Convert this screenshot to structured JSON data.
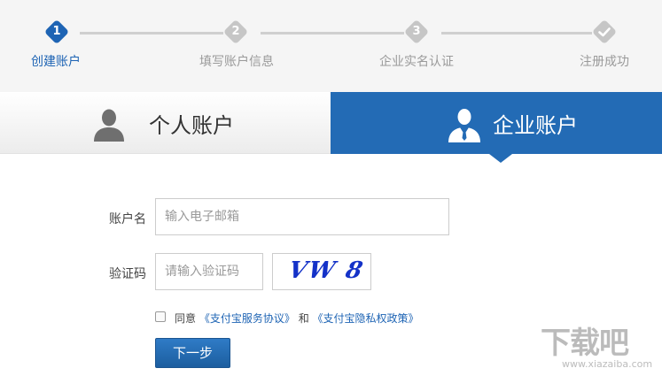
{
  "steps": [
    {
      "number": "1",
      "label": "创建账户",
      "active": true
    },
    {
      "number": "2",
      "label": "填写账户信息",
      "active": false
    },
    {
      "number": "3",
      "label": "企业实名认证",
      "active": false
    },
    {
      "number": "check-icon",
      "label": "注册成功",
      "active": false
    }
  ],
  "tabs": {
    "personal": {
      "label": "个人账户",
      "icon": "user-icon"
    },
    "enterprise": {
      "label": "企业账户",
      "icon": "business-user-icon",
      "selected": true
    }
  },
  "form": {
    "account_label": "账户名",
    "account_placeholder": "输入电子邮箱",
    "account_value": "",
    "captcha_label": "验证码",
    "captcha_placeholder": "请输入验证码",
    "captcha_value": "",
    "captcha_image_text": "VW 8"
  },
  "agreement": {
    "checked": false,
    "prefix": "同意",
    "link1": "《支付宝服务协议》",
    "conj": "和",
    "link2": "《支付宝隐私权政策》"
  },
  "next_button": "下一步",
  "watermark": {
    "title": "下载吧",
    "url": "www.xiazaiba.com"
  },
  "colors": {
    "accent": "#236bb5",
    "inactive": "#c6c6c6",
    "link": "#1e64b4"
  }
}
